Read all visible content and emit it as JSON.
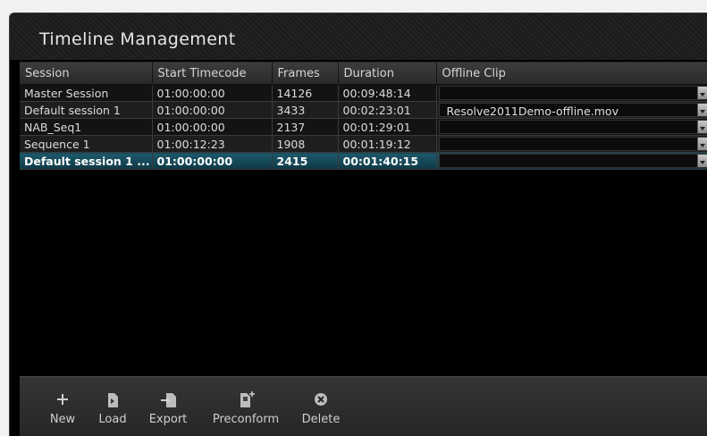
{
  "panel": {
    "title": "Timeline Management"
  },
  "table": {
    "columns": [
      "Session",
      "Start Timecode",
      "Frames",
      "Duration",
      "Offline Clip"
    ],
    "rows": [
      {
        "session": "Master Session",
        "start": "01:00:00:00",
        "frames": "14126",
        "duration": "00:09:48:14",
        "clip": ""
      },
      {
        "session": "Default session 1",
        "start": "01:00:00:00",
        "frames": "3433",
        "duration": "00:02:23:01",
        "clip": "Resolve2011Demo-offline.mov"
      },
      {
        "session": "NAB_Seq1",
        "start": "01:00:00:00",
        "frames": "2137",
        "duration": "00:01:29:01",
        "clip": ""
      },
      {
        "session": "Sequence 1",
        "start": "01:00:12:23",
        "frames": "1908",
        "duration": "00:01:19:12",
        "clip": ""
      },
      {
        "session": "Default session 1 ...",
        "start": "01:00:00:00",
        "frames": "2415",
        "duration": "00:01:40:15",
        "clip": ""
      }
    ],
    "selected_row": 4
  },
  "toolbar": {
    "new_label": "New",
    "load_label": "Load",
    "export_label": "Export",
    "preconform_label": "Preconform",
    "delete_label": "Delete"
  },
  "colors": {
    "selection": "#1d5a6c",
    "background": "#000000"
  }
}
